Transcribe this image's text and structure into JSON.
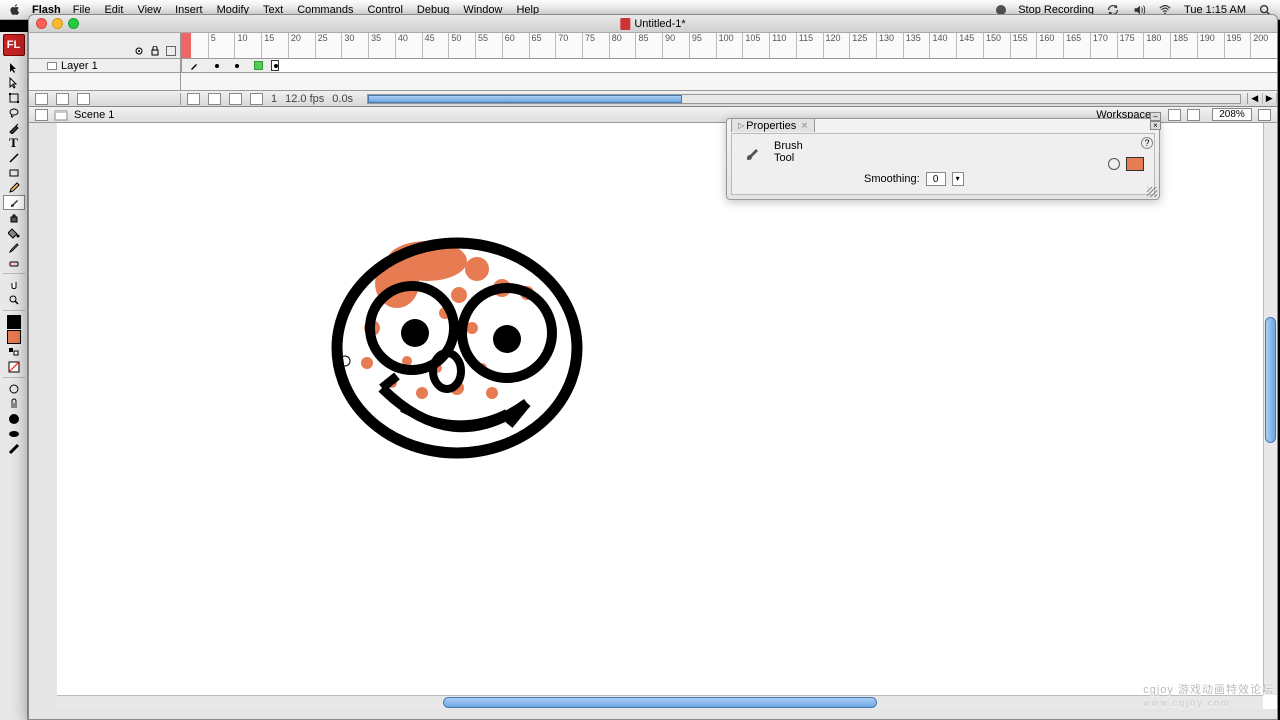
{
  "menubar": {
    "app": "Flash",
    "items": [
      "File",
      "Edit",
      "View",
      "Insert",
      "Modify",
      "Text",
      "Commands",
      "Control",
      "Debug",
      "Window",
      "Help"
    ],
    "status_rec": "Stop Recording",
    "clock": "Tue 1:15 AM"
  },
  "window": {
    "title": "Untitled-1*"
  },
  "ruler": {
    "marks": [
      5,
      10,
      15,
      20,
      25,
      30,
      35,
      40,
      45,
      50,
      55,
      60,
      65,
      70,
      75,
      80,
      85,
      90,
      95,
      100,
      105,
      110,
      115,
      120,
      125,
      130,
      135,
      140,
      145,
      150,
      155,
      160,
      165,
      170,
      175,
      180,
      185,
      190,
      195,
      200
    ]
  },
  "layers": {
    "layer1": "Layer 1"
  },
  "timeline_status": {
    "frame": "1",
    "fps": "12.0 fps",
    "time": "0.0s"
  },
  "scene": {
    "name": "Scene 1",
    "workspace_label": "Workspace",
    "zoom": "208%"
  },
  "properties": {
    "panel_title": "Properties",
    "tool_line1": "Brush",
    "tool_line2": "Tool",
    "smoothing_label": "Smoothing:",
    "smoothing_value": "0",
    "fill_color": "#e77b52"
  },
  "tools": {
    "app_badge": "FL"
  },
  "watermark": {
    "line1": "cgjoy 游戏动画特效论坛",
    "line2": "www.cgjoy.com"
  }
}
